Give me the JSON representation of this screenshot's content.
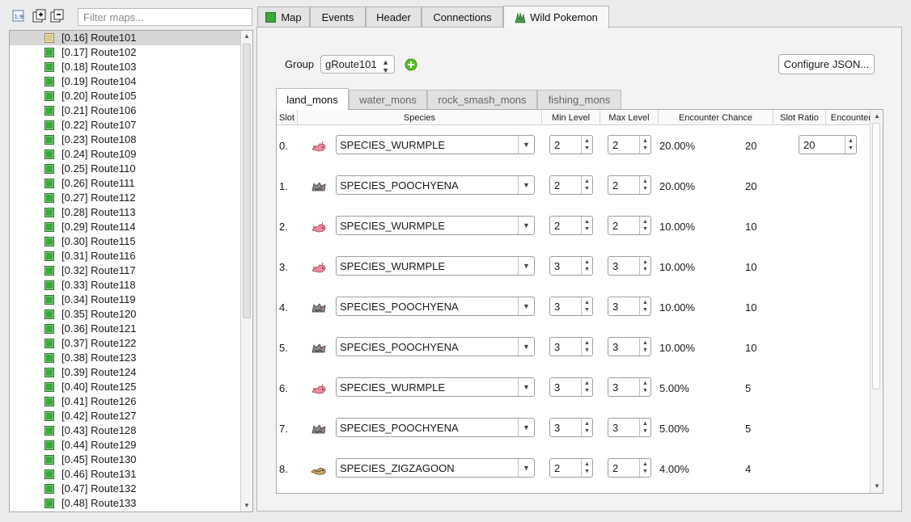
{
  "filter": {
    "placeholder": "Filter maps..."
  },
  "maps": [
    "[0.16] Route101",
    "[0.17] Route102",
    "[0.18] Route103",
    "[0.19] Route104",
    "[0.20] Route105",
    "[0.21] Route106",
    "[0.22] Route107",
    "[0.23] Route108",
    "[0.24] Route109",
    "[0.25] Route110",
    "[0.26] Route111",
    "[0.27] Route112",
    "[0.28] Route113",
    "[0.29] Route114",
    "[0.30] Route115",
    "[0.31] Route116",
    "[0.32] Route117",
    "[0.33] Route118",
    "[0.34] Route119",
    "[0.35] Route120",
    "[0.36] Route121",
    "[0.37] Route122",
    "[0.38] Route123",
    "[0.39] Route124",
    "[0.40] Route125",
    "[0.41] Route126",
    "[0.42] Route127",
    "[0.43] Route128",
    "[0.44] Route129",
    "[0.45] Route130",
    "[0.46] Route131",
    "[0.47] Route132",
    "[0.48] Route133"
  ],
  "selected_map": "[0.16] Route101",
  "tabs": [
    "Map",
    "Events",
    "Header",
    "Connections",
    "Wild Pokemon"
  ],
  "active_tab": "Wild Pokemon",
  "group": {
    "label": "Group",
    "value": "gRoute101"
  },
  "configure_button": "Configure JSON...",
  "subtabs": [
    "land_mons",
    "water_mons",
    "rock_smash_mons",
    "fishing_mons"
  ],
  "active_subtab": "land_mons",
  "columns": [
    "Slot",
    "Species",
    "Min Level",
    "Max Level",
    "Encounter Chance",
    "Slot Ratio",
    "Encounter Rate"
  ],
  "encounter_rate": "20",
  "rows": [
    {
      "slot": "0.",
      "species": "SPECIES_WURMPLE",
      "icon": "wurmple-icon",
      "min": "2",
      "max": "2",
      "chance": "20.00%",
      "ratio": "20"
    },
    {
      "slot": "1.",
      "species": "SPECIES_POOCHYENA",
      "icon": "poochyena-icon",
      "min": "2",
      "max": "2",
      "chance": "20.00%",
      "ratio": "20"
    },
    {
      "slot": "2.",
      "species": "SPECIES_WURMPLE",
      "icon": "wurmple-icon",
      "min": "2",
      "max": "2",
      "chance": "10.00%",
      "ratio": "10"
    },
    {
      "slot": "3.",
      "species": "SPECIES_WURMPLE",
      "icon": "wurmple-icon",
      "min": "3",
      "max": "3",
      "chance": "10.00%",
      "ratio": "10"
    },
    {
      "slot": "4.",
      "species": "SPECIES_POOCHYENA",
      "icon": "poochyena-icon",
      "min": "3",
      "max": "3",
      "chance": "10.00%",
      "ratio": "10"
    },
    {
      "slot": "5.",
      "species": "SPECIES_POOCHYENA",
      "icon": "poochyena-icon",
      "min": "3",
      "max": "3",
      "chance": "10.00%",
      "ratio": "10"
    },
    {
      "slot": "6.",
      "species": "SPECIES_WURMPLE",
      "icon": "wurmple-icon",
      "min": "3",
      "max": "3",
      "chance": "5.00%",
      "ratio": "5"
    },
    {
      "slot": "7.",
      "species": "SPECIES_POOCHYENA",
      "icon": "poochyena-icon",
      "min": "3",
      "max": "3",
      "chance": "5.00%",
      "ratio": "5"
    },
    {
      "slot": "8.",
      "species": "SPECIES_ZIGZAGOON",
      "icon": "zigzagoon-icon",
      "min": "2",
      "max": "2",
      "chance": "4.00%",
      "ratio": "4"
    }
  ]
}
